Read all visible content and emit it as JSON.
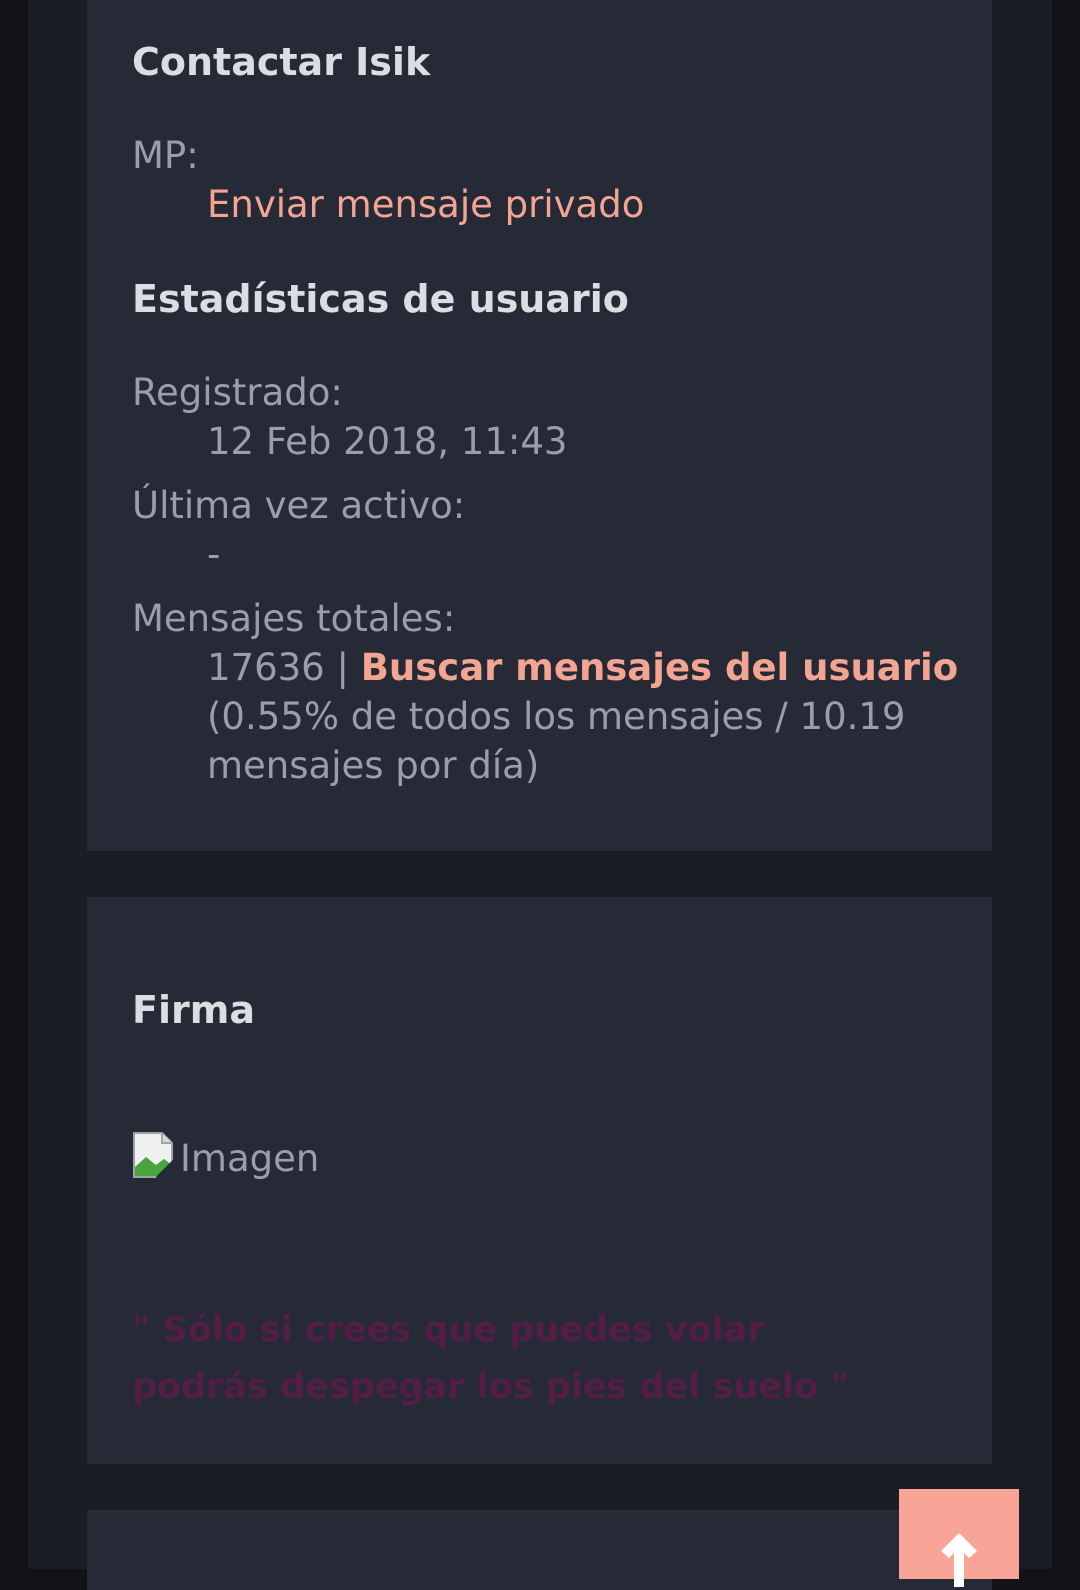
{
  "contact": {
    "heading": "Contactar Isik",
    "pm_label": "MP:",
    "pm_link": "Enviar mensaje privado"
  },
  "stats": {
    "heading": "Estadísticas de usuario",
    "registered_label": "Registrado:",
    "registered_value": "12 Feb 2018, 11:43",
    "last_active_label": "Última vez activo:",
    "last_active_value": "-",
    "total_posts_label": "Mensajes totales:",
    "total_posts_count": "17636 |",
    "search_posts_link": "Buscar mensajes del usuario",
    "posts_ratio_line1": "(0.55% de todos los mensajes / 10.19",
    "posts_ratio_line2": "mensajes por día)"
  },
  "signature": {
    "heading": "Firma",
    "image_alt": "Imagen",
    "quote": "\" Sólo si crees que puedes volar podrás despegar los pies del suelo \""
  },
  "colors": {
    "accent_link": "#f4a492",
    "panel_bg": "#262a36",
    "back_to_top_bg": "#f8a598",
    "quote_color": "#541d45"
  },
  "icons": {
    "back_to_top": "arrow-up-icon",
    "broken_image": "broken-image-icon"
  }
}
